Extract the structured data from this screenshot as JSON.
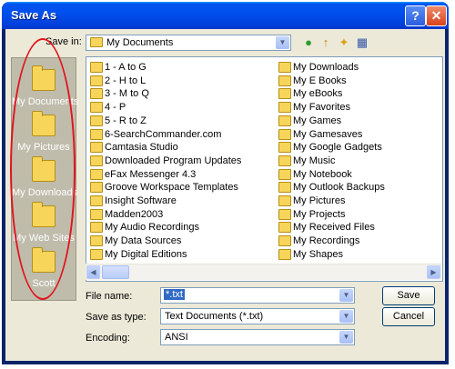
{
  "window": {
    "title": "Save As",
    "help_glyph": "?",
    "close_glyph": "✕"
  },
  "toolbar": {
    "save_in_label": "Save in:",
    "save_in_value": "My Documents",
    "back_glyph": "●",
    "up_glyph": "↑",
    "new_folder_glyph": "✦",
    "views_glyph": "▦"
  },
  "places": [
    {
      "label": "My Documents"
    },
    {
      "label": "My Pictures"
    },
    {
      "label": "My Downloads"
    },
    {
      "label": "My Web Sites"
    },
    {
      "label": "Scott"
    }
  ],
  "files_col1": [
    "1 - A to G",
    "2 - H to L",
    "3 - M to Q",
    "4 - P",
    "5 - R to Z",
    "6-SearchCommander.com",
    "Camtasia Studio",
    "Downloaded Program Updates",
    "eFax Messenger 4.3",
    "Groove Workspace Templates",
    "Insight Software",
    "Madden2003",
    "My Audio Recordings",
    "My Data Sources",
    "My Digital Editions"
  ],
  "files_col2": [
    "My Downloads",
    "My E Books",
    "My eBooks",
    "My Favorites",
    "My Games",
    "My Gamesaves",
    "My Google Gadgets",
    "My Music",
    "My Notebook",
    "My Outlook Backups",
    "My Pictures",
    "My Projects",
    "My Received Files",
    "My Recordings",
    "My Shapes"
  ],
  "form": {
    "file_name_label": "File name:",
    "file_name_value": "*.txt",
    "save_as_type_label": "Save as type:",
    "save_as_type_value": "Text Documents (*.txt)",
    "encoding_label": "Encoding:",
    "encoding_value": "ANSI"
  },
  "buttons": {
    "save": "Save",
    "cancel": "Cancel"
  },
  "colors": {
    "titlebar": "#0053ee",
    "places_bg": "#bfbcac",
    "annotation_oval": "#e0141e"
  }
}
